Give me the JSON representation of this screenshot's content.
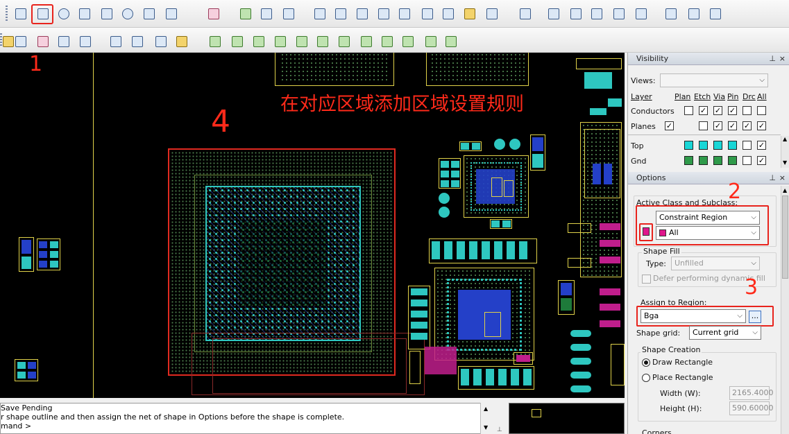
{
  "toolbar": {
    "row1_icons": [
      "shape-add-icon",
      "shape-rectangle-icon",
      "shape-circle-icon",
      "select-shape-icon",
      "manual-void-icon",
      "void-circle-icon",
      "void-rectangle-icon",
      "void-element-icon",
      "edit-boundary-icon",
      "merge-shapes-icon",
      "dimension-icon",
      "dimension-linear-icon",
      "odb-export-icon",
      "layers-icon",
      "edit-icon",
      "snapshot-icon",
      "film-icon",
      "report-icon",
      "grid-icon",
      "tool-icon",
      "matrix-icon",
      "waveform-icon",
      "spreadsheet-icon",
      "book-icon",
      "check-icon",
      "wrench-icon",
      "windows-icon",
      "mail-icon",
      "envelope-icon",
      "help-icon"
    ],
    "row2_icons": [
      "pencil-icon",
      "chevrons-icon",
      "text-icon",
      "pattern-icon",
      "wave-icon",
      "line-icon",
      "rect-icon",
      "add-text-icon",
      "edit-text-icon",
      "net-icon-1",
      "net-icon-2",
      "net-icon-3",
      "net-icon-4",
      "net-icon-5",
      "net-icon-6",
      "net-icon-7",
      "net-icon-8",
      "net-icon-9",
      "net-icon-10",
      "net-icon-11",
      "net-icon-12"
    ]
  },
  "annotations": {
    "step1": "1",
    "step2": "2",
    "step3": "3",
    "step4": "4",
    "caption": "在对应区域添加区域设置规则"
  },
  "command": {
    "lines": [
      "Save Pending",
      "r shape outline and then assign the net of shape in Options before the shape is complete.",
      "mand >"
    ]
  },
  "visibility": {
    "title": "Visibility",
    "views_label": "Views:",
    "views_value": "",
    "columns": {
      "layer": "Layer",
      "plan": "Plan",
      "etch": "Etch",
      "via": "Via",
      "pin": "Pin",
      "drc": "Drc",
      "all": "All"
    },
    "rows": [
      {
        "name": "Conductors",
        "checks": [
          false,
          true,
          true,
          true,
          false,
          false
        ]
      },
      {
        "name": "Planes",
        "checks": [
          true,
          false,
          true,
          true,
          true,
          true
        ]
      },
      {
        "name": "Top",
        "colors": [
          "#19d6d6",
          "#19d6d6",
          "#19d6d6",
          "#19d6d6"
        ],
        "checks": [
          false,
          true
        ]
      },
      {
        "name": "Gnd",
        "colors": [
          "#2f9a4a",
          "#2f9a4a",
          "#2f9a4a",
          "#2f9a4a"
        ],
        "checks": [
          false,
          true
        ]
      }
    ]
  },
  "options": {
    "title": "Options",
    "active_class_label": "Active Class and Subclass:",
    "class_value": "Constraint Region",
    "subclass_value": "All",
    "subclass_color": "#e0158c",
    "shape_fill_label": "Shape Fill",
    "type_label": "Type:",
    "type_value": "Unfilled",
    "defer_label": "Defer performing dynamic fill",
    "assign_label": "Assign to Region:",
    "region_value": "Bga",
    "browse_label": "...",
    "grid_label": "Shape grid:",
    "grid_value": "Current grid",
    "creation_label": "Shape Creation",
    "draw_label": "Draw Rectangle",
    "place_label": "Place Rectangle",
    "width_label": "Width (W):",
    "width_value": "2165.4000",
    "height_label": "Height (H):",
    "height_value": "590.60000",
    "corners_label": "Corners"
  },
  "colors": {
    "annotation": "#ff2a1a",
    "canvas": "#000000",
    "region_outline": "#e02a20"
  }
}
